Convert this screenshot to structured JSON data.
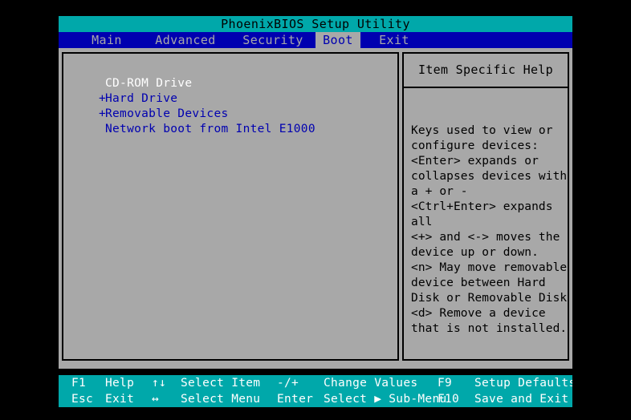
{
  "window": {
    "title": "PhoenixBIOS Setup Utility"
  },
  "menu": {
    "tabs": [
      {
        "label": "Main",
        "active": false
      },
      {
        "label": "Advanced",
        "active": false
      },
      {
        "label": "Security",
        "active": false
      },
      {
        "label": "Boot",
        "active": true
      },
      {
        "label": "Exit",
        "active": false
      }
    ]
  },
  "boot_list": {
    "items": [
      {
        "prefix": " ",
        "label": "CD-ROM Drive",
        "style": "white"
      },
      {
        "prefix": "+",
        "label": "Hard Drive",
        "style": "blue"
      },
      {
        "prefix": "+",
        "label": "Removable Devices",
        "style": "blue"
      },
      {
        "prefix": " ",
        "label": "Network boot from Intel E1000",
        "style": "blue"
      }
    ]
  },
  "help": {
    "header": "Item Specific Help",
    "lines": [
      "Keys used to view or",
      "configure devices:",
      "<Enter> expands or",
      "collapses devices with",
      "a + or -",
      "<Ctrl+Enter> expands",
      "all",
      "<+> and <-> moves the",
      "device up or down.",
      "<n> May move removable",
      "device between Hard",
      "Disk or Removable Disk",
      "<d> Remove a device",
      "that is not installed."
    ]
  },
  "status_bar": {
    "row1": [
      {
        "key": "F1",
        "desc": "Help"
      },
      {
        "key": "↑↓",
        "desc": "Select Item"
      },
      {
        "key": "-/+",
        "desc": "Change Values"
      },
      {
        "key": "F9",
        "desc": "Setup Defaults"
      }
    ],
    "row2": [
      {
        "key": "Esc",
        "desc": "Exit"
      },
      {
        "key": "↔",
        "desc": "Select Menu"
      },
      {
        "key": "Enter",
        "desc": "Select ▶ Sub-Menu"
      },
      {
        "key": "F10",
        "desc": "Save and Exit"
      }
    ]
  },
  "colors": {
    "teal": "#00a8aa",
    "blue": "#0000b0",
    "grey": "#a8a8a8",
    "white": "#ffffff",
    "black": "#000000"
  }
}
